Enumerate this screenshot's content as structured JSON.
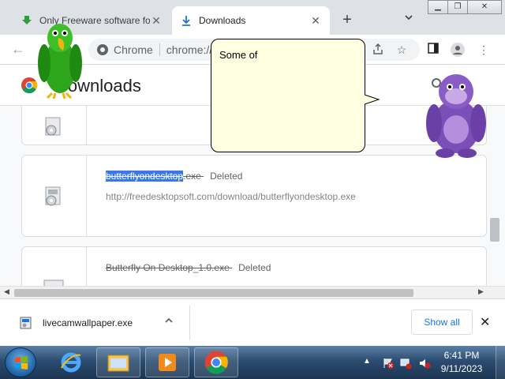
{
  "browser": {
    "tabs": [
      {
        "title": "Only Freeware software fo",
        "icon": "download-arrow-icon",
        "active": false
      },
      {
        "title": "Downloads",
        "icon": "download-icon",
        "active": true
      }
    ],
    "address": {
      "site_label": "Chrome",
      "url": "chrome://downloads"
    }
  },
  "downloads_page": {
    "title": "Downloads",
    "items": [
      {
        "name_highlight": "butterflyondesktop",
        "name_rest": ".exe",
        "status": "Deleted",
        "url": "http://freedesktopsoft.com/download/butterflyondesktop.exe"
      },
      {
        "name": "Butterfly On Desktop_1.0.exe",
        "status": "Deleted"
      }
    ]
  },
  "shelf": {
    "item_name": "livecamwallpaper.exe",
    "show_all": "Show all"
  },
  "speech_bubble": {
    "text": "Some of"
  },
  "taskbar": {
    "time": "6:41 PM",
    "date": "9/11/2023"
  },
  "colors": {
    "accent": "#1a73e8",
    "selection": "#3b78e7",
    "bubble": "#ffffe1",
    "parrot": "#2fa51d",
    "gorilla": "#7b4fb8"
  }
}
